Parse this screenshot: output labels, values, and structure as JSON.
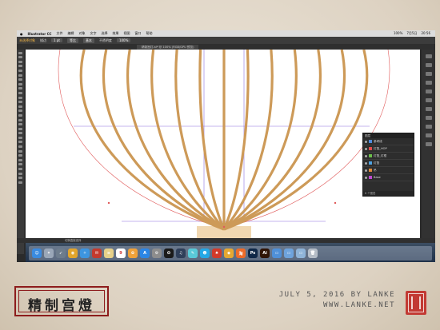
{
  "menubar": {
    "app_name": "Illustrator CC",
    "items": [
      "文件",
      "编辑",
      "对象",
      "文字",
      "选择",
      "效果",
      "视图",
      "窗口",
      "帮助"
    ],
    "status": [
      "100%",
      "7月5日",
      "20:56"
    ]
  },
  "control_bar": {
    "selection": "未选择对象",
    "stroke_label": "描边",
    "fields": [
      "1 pt",
      "等比",
      "基本",
      "不透明度",
      "100%"
    ]
  },
  "document_tab": {
    "title": "精制宫灯.ai* @ 100% (RGB/GPU 预览)"
  },
  "status_bar": {
    "text": "切换直接选择"
  },
  "layers_panel": {
    "title": "图层",
    "layers": [
      {
        "name": "参考线",
        "color": "#4f8bdc"
      },
      {
        "name": "灯笼_HOP",
        "color": "#e34b4b"
      },
      {
        "name": "灯笼_灯框",
        "color": "#6bbf4a"
      },
      {
        "name": "灯笼",
        "color": "#4fa3e3"
      },
      {
        "name": "吊",
        "color": "#e08a3a"
      },
      {
        "name": "Base",
        "color": "#c04ad0"
      }
    ],
    "footer": "6 个图层"
  },
  "dock": {
    "apps": [
      {
        "name": "finder-icon",
        "color": "#3a8be0",
        "glyph": "☺"
      },
      {
        "name": "launchpad-icon",
        "color": "#9aa7b8",
        "glyph": "✦"
      },
      {
        "name": "rocket-icon",
        "color": "#6d7c8c",
        "glyph": "➶"
      },
      {
        "name": "chrome-icon",
        "color": "#e3a52c",
        "glyph": "◉"
      },
      {
        "name": "safari-icon",
        "color": "#3d95e0",
        "glyph": "✧"
      },
      {
        "name": "mail-icon",
        "color": "#c43a2d",
        "glyph": "✉"
      },
      {
        "name": "notes-icon",
        "color": "#e6d089",
        "glyph": "≡"
      },
      {
        "name": "calendar-icon",
        "color": "#ffffff",
        "glyph": "9"
      },
      {
        "name": "photos-icon",
        "color": "#f0a23a",
        "glyph": "✿"
      },
      {
        "name": "appstore-icon",
        "color": "#2b86e6",
        "glyph": "A"
      },
      {
        "name": "prefs-icon",
        "color": "#8d8d8d",
        "glyph": "⚙"
      },
      {
        "name": "qq-icon",
        "color": "#1b1b1b",
        "glyph": "✪"
      },
      {
        "name": "music-icon",
        "color": "#2f3f5a",
        "glyph": "♫"
      },
      {
        "name": "messages-icon",
        "color": "#59c9d8",
        "glyph": "✎"
      },
      {
        "name": "penguin-icon",
        "color": "#24a8e6",
        "glyph": "☻"
      },
      {
        "name": "weibo-icon",
        "color": "#d23a2a",
        "glyph": "♠"
      },
      {
        "name": "sketch-icon",
        "color": "#e6a832",
        "glyph": "◆"
      },
      {
        "name": "taobao-icon",
        "color": "#ef6b28",
        "glyph": "淘"
      },
      {
        "name": "photoshop-icon",
        "color": "#0f2848",
        "glyph": "Ps"
      },
      {
        "name": "illustrator-icon",
        "color": "#2f1406",
        "glyph": "Ai"
      },
      {
        "name": "folder-icon",
        "color": "#4f90d8",
        "glyph": "▭"
      },
      {
        "name": "folder2-icon",
        "color": "#6ea3dc",
        "glyph": "▭"
      },
      {
        "name": "download-icon",
        "color": "#8fb4d8",
        "glyph": "▭"
      },
      {
        "name": "trash-icon",
        "color": "#b5bdc7",
        "glyph": "🗑"
      }
    ]
  },
  "branding": {
    "title": "精制宫燈",
    "date_line": "JULY 5, 2016 BY LANKE",
    "site": "WWW.LANKE.NET"
  },
  "colors": {
    "rib": "#cd9a58",
    "base": "#f0d7b1",
    "guide_purple": "#8b6fe0",
    "outline_red": "#e05a5a"
  }
}
